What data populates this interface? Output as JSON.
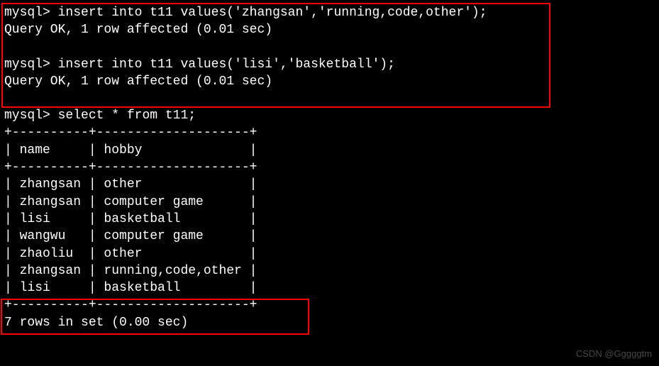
{
  "prompt": "mysql>",
  "cmd1": "insert into t11 values('zhangsan','running,code,other');",
  "res1": "Query OK, 1 row affected (0.01 sec)",
  "cmd2": "insert into t11 values('lisi','basketball');",
  "res2": "Query OK, 1 row affected (0.01 sec)",
  "cmd3": "select * from t11;",
  "table": {
    "border_top": "+----------+--------------------+",
    "header_row": "| name     | hobby              |",
    "border_mid": "+----------+--------------------+",
    "rows": [
      "| zhangsan | other              |",
      "| zhangsan | computer game      |",
      "| lisi     | basketball         |",
      "| wangwu   | computer game      |",
      "| zhaoliu  | other              |",
      "| zhangsan | running,code,other |",
      "| lisi     | basketball         |"
    ],
    "border_bot": "+----------+--------------------+"
  },
  "footer": "7 rows in set (0.00 sec)",
  "watermark": "CSDN @Gggggtm",
  "chart_data": {
    "type": "table",
    "columns": [
      "name",
      "hobby"
    ],
    "rows": [
      [
        "zhangsan",
        "other"
      ],
      [
        "zhangsan",
        "computer game"
      ],
      [
        "lisi",
        "basketball"
      ],
      [
        "wangwu",
        "computer game"
      ],
      [
        "zhaoliu",
        "other"
      ],
      [
        "zhangsan",
        "running,code,other"
      ],
      [
        "lisi",
        "basketball"
      ]
    ]
  }
}
